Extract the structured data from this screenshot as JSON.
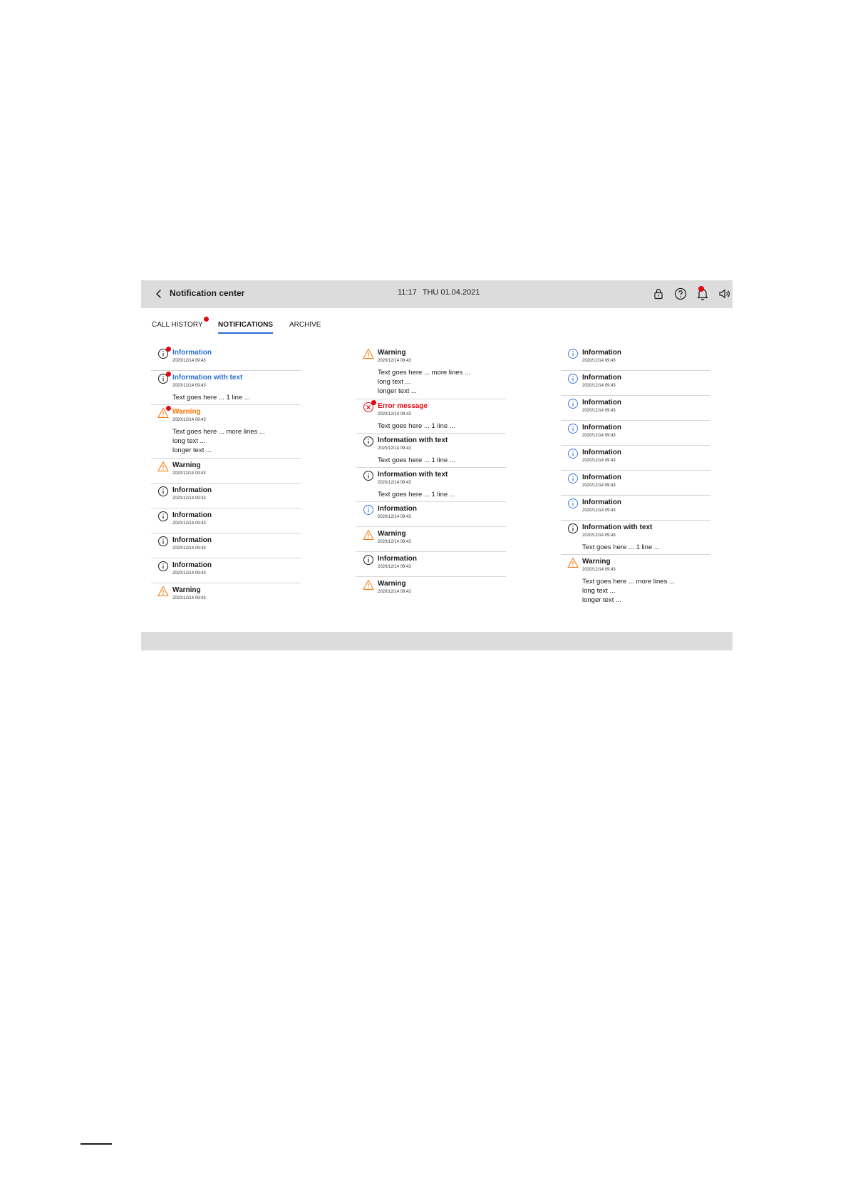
{
  "header": {
    "title": "Notification center",
    "time": "11:17",
    "date": "THU 01.04.2021"
  },
  "colors": {
    "accent_blue": "#2b6fd6",
    "warning_orange": "#ff7300",
    "error_red": "#e30613",
    "bar_gray": "#dcdcdc"
  },
  "toolbar_icons": [
    "back-arrow-icon",
    "lock-icon",
    "help-icon",
    "bell-icon",
    "speaker-icon"
  ],
  "tabs": [
    {
      "label": "CALL HISTORY",
      "active": false,
      "badge": true
    },
    {
      "label": "NOTIFICATIONS",
      "active": true,
      "badge": false
    },
    {
      "label": "ARCHIVE",
      "active": false,
      "badge": false
    }
  ],
  "columns": [
    [
      {
        "type": "info",
        "title": "Information",
        "time": "2020/12/14 09:43",
        "text": "",
        "unread": true
      },
      {
        "type": "info",
        "title": "Information with text",
        "time": "2020/12/14 09:43",
        "text": "Text goes here ... 1 line ...",
        "unread": true
      },
      {
        "type": "warning",
        "title": "Warning",
        "time": "2020/12/14 09:43",
        "text": "Text goes here ... more lines ...\nlong text ...\nlonger text ...",
        "unread": true
      },
      {
        "type": "warning",
        "title": "Warning",
        "time": "2020/12/14 09:43",
        "text": "",
        "unread": false
      },
      {
        "type": "info",
        "title": "Information",
        "time": "2020/12/14 09:43",
        "text": "",
        "unread": false
      },
      {
        "type": "info",
        "title": "Information",
        "time": "2020/12/14 09:43",
        "text": "",
        "unread": false
      },
      {
        "type": "info",
        "title": "Information",
        "time": "2020/12/14 09:43",
        "text": "",
        "unread": false
      },
      {
        "type": "info",
        "title": "Information",
        "time": "2020/12/14 09:43",
        "text": "",
        "unread": false
      },
      {
        "type": "warning",
        "title": "Warning",
        "time": "2020/12/14 09:43",
        "text": "",
        "unread": false
      }
    ],
    [
      {
        "type": "warning",
        "title": "Warning",
        "time": "2020/12/14 09:43",
        "text": "Text goes here ... more lines ...\nlong text ...\nlonger text ...",
        "unread": false
      },
      {
        "type": "error",
        "title": "Error message",
        "time": "2020/12/14 09:43",
        "text": "Text goes here ... 1 line ...",
        "unread": true
      },
      {
        "type": "info",
        "title": "Information with text",
        "time": "2020/12/14 09:43",
        "text": "Text goes here ... 1 line ...",
        "unread": false
      },
      {
        "type": "info",
        "title": "Information with text",
        "time": "2020/12/14 09:43",
        "text": "Text goes here ... 1 line ...",
        "unread": false
      },
      {
        "type": "info-light",
        "title": "Information",
        "time": "2020/12/14 09:43",
        "text": "",
        "unread": false
      },
      {
        "type": "warning",
        "title": "Warning",
        "time": "2020/12/14 09:43",
        "text": "",
        "unread": false
      },
      {
        "type": "info",
        "title": "Information",
        "time": "2020/12/14 09:43",
        "text": "",
        "unread": false
      },
      {
        "type": "warning",
        "title": "Warning",
        "time": "2020/12/14 09:43",
        "text": "",
        "unread": false
      }
    ],
    [
      {
        "type": "info-light",
        "title": "Information",
        "time": "2020/12/14 09:43",
        "text": "",
        "unread": false
      },
      {
        "type": "info-light",
        "title": "Information",
        "time": "2020/12/14 09:43",
        "text": "",
        "unread": false
      },
      {
        "type": "info-light",
        "title": "Information",
        "time": "2020/12/14 09:43",
        "text": "",
        "unread": false
      },
      {
        "type": "info-light",
        "title": "Information",
        "time": "2020/12/14 09:43",
        "text": "",
        "unread": false
      },
      {
        "type": "info-light",
        "title": "Information",
        "time": "2020/12/14 09:43",
        "text": "",
        "unread": false
      },
      {
        "type": "info-light",
        "title": "Information",
        "time": "2020/12/14 09:43",
        "text": "",
        "unread": false
      },
      {
        "type": "info-light",
        "title": "Information",
        "time": "2020/12/14 09:43",
        "text": "",
        "unread": false
      },
      {
        "type": "info",
        "title": "Information with text",
        "time": "2020/12/14 09:43",
        "text": "Text goes here ... 1 line ...",
        "unread": false
      },
      {
        "type": "warning",
        "title": "Warning",
        "time": "2020/12/14 09:43",
        "text": "Text goes here ... more lines ...\nlong text ...\nlonger text ...",
        "unread": false
      }
    ]
  ]
}
